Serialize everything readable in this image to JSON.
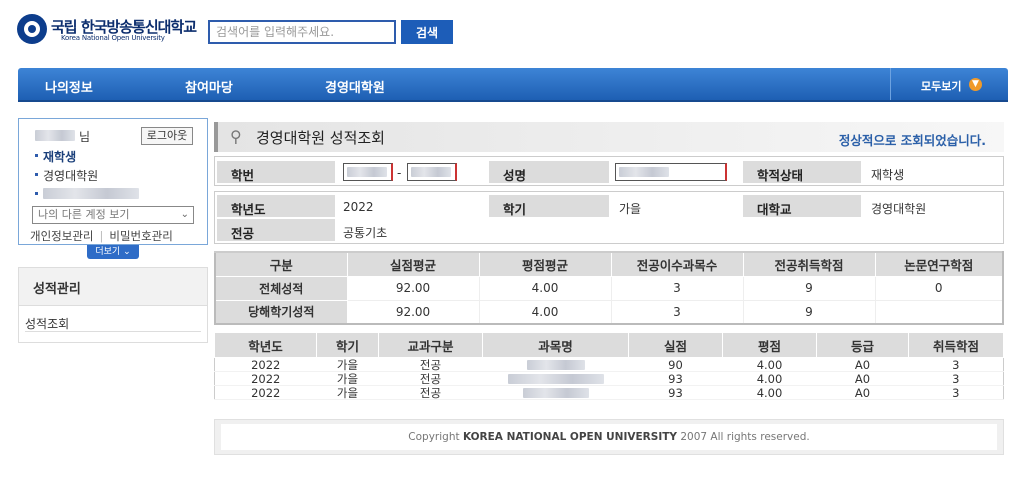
{
  "header": {
    "logo_kr": "국립 한국방송통신대학교",
    "logo_en": "Korea National Open University",
    "search_placeholder": "검색어를 입력해주세요.",
    "search_button": "검색"
  },
  "nav": {
    "items": [
      "나의정보",
      "참여마당",
      "경영대학원"
    ],
    "allview": "모두보기"
  },
  "user": {
    "suffix": "님",
    "logout": "로그아웃",
    "status": "재학생",
    "school": "경영대학원",
    "account_select": "나의 다른 계정 보기",
    "link_personal": "개인정보관리",
    "link_password": "비밀번호관리",
    "more": "더보기"
  },
  "sidemenu": {
    "title": "성적관리",
    "item": "성적조회"
  },
  "page": {
    "title": "경영대학원 성적조회",
    "message": "정상적으로 조회되었습니다."
  },
  "info": {
    "student_id_label": "학번",
    "id_separator": "-",
    "name_label": "성명",
    "status_label": "학적상태",
    "status_value": "재학생",
    "year_label": "학년도",
    "year_value": "2022",
    "semester_label": "학기",
    "semester_value": "가을",
    "college_label": "대학교",
    "college_value": "경영대학원",
    "major_label": "전공",
    "major_value": "공통기초"
  },
  "summary": {
    "headers": [
      "구분",
      "실점평균",
      "평점평균",
      "전공이수과목수",
      "전공취득학점",
      "논문연구학점"
    ],
    "rows": [
      [
        "전체성적",
        "92.00",
        "4.00",
        "3",
        "9",
        "0"
      ],
      [
        "당해학기성적",
        "92.00",
        "4.00",
        "3",
        "9",
        ""
      ]
    ]
  },
  "courses": {
    "headers": [
      "학년도",
      "학기",
      "교과구분",
      "과목명",
      "실점",
      "평점",
      "등급",
      "취득학점"
    ],
    "rows": [
      [
        "2022",
        "가을",
        "전공",
        "",
        "90",
        "4.00",
        "A0",
        "3"
      ],
      [
        "2022",
        "가을",
        "전공",
        "",
        "93",
        "4.00",
        "A0",
        "3"
      ],
      [
        "2022",
        "가을",
        "전공",
        "",
        "93",
        "4.00",
        "A0",
        "3"
      ]
    ]
  },
  "footer": {
    "prefix": "Copyright",
    "org": "KOREA NATIONAL OPEN UNIVERSITY",
    "suffix": "2007 All rights reserved."
  }
}
